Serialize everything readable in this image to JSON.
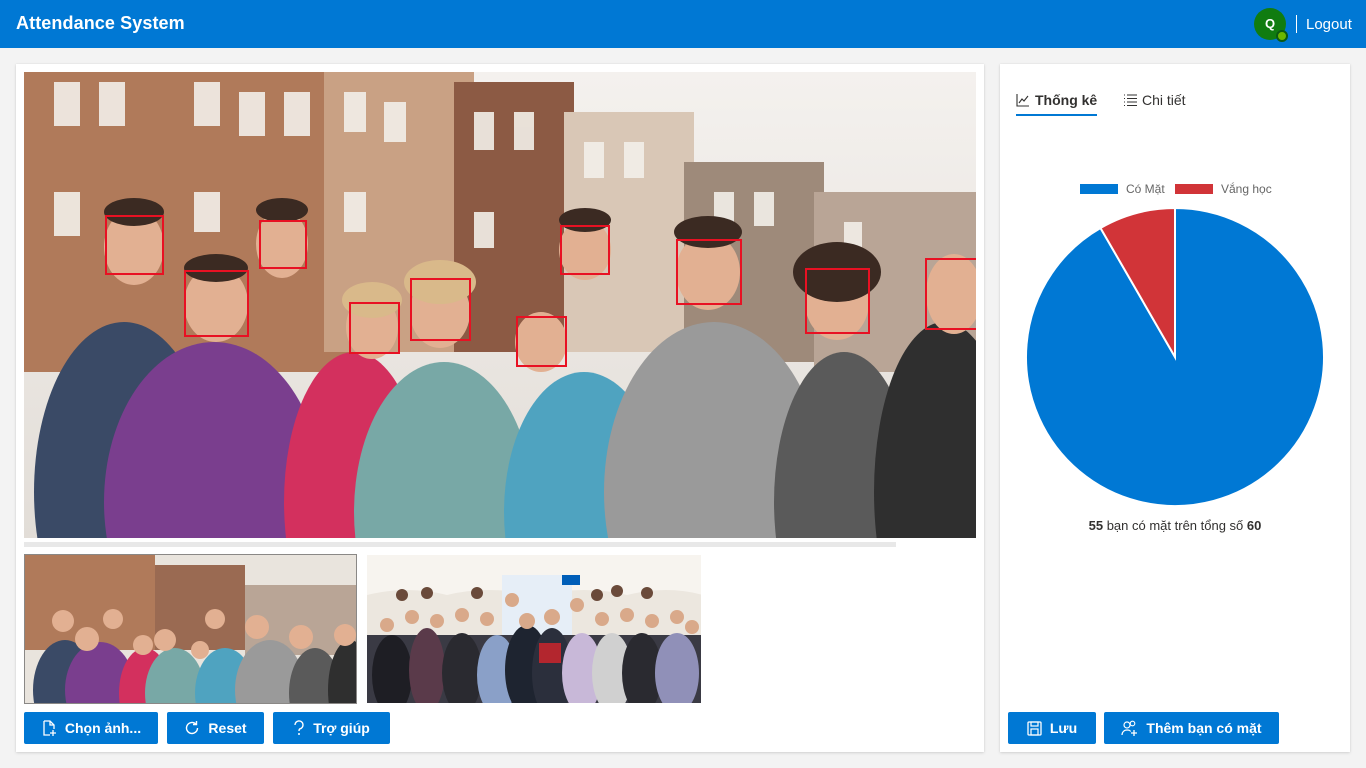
{
  "header": {
    "title": "Attendance System",
    "avatar_initial": "Q",
    "logout_label": "Logout"
  },
  "photo_panel": {
    "buttons": {
      "choose_label": "Chọn ảnh...",
      "reset_label": "Reset",
      "help_label": "Trợ giúp"
    },
    "detected_faces": 10,
    "thumbnails": 2
  },
  "stats_panel": {
    "tabs": [
      {
        "label": "Thống kê",
        "icon": "line-chart-icon",
        "active": true
      },
      {
        "label": "Chi tiết",
        "icon": "list-icon",
        "active": false
      }
    ],
    "summary": {
      "present": "55",
      "middle_text": " bạn có mặt trên tổng số ",
      "total": "60"
    },
    "buttons": {
      "save_label": "Lưu",
      "add_label": "Thêm bạn có mặt"
    }
  },
  "chart_data": {
    "type": "pie",
    "legend_position": "top",
    "labels": [
      "Có Mặt",
      "Vắng học"
    ],
    "values": [
      55,
      5
    ],
    "colors": [
      "#0078d4",
      "#d13438"
    ]
  },
  "colors": {
    "accent": "#0078d4",
    "absent": "#d13438",
    "face_box": "#e81123",
    "presence": "#6bb700"
  }
}
